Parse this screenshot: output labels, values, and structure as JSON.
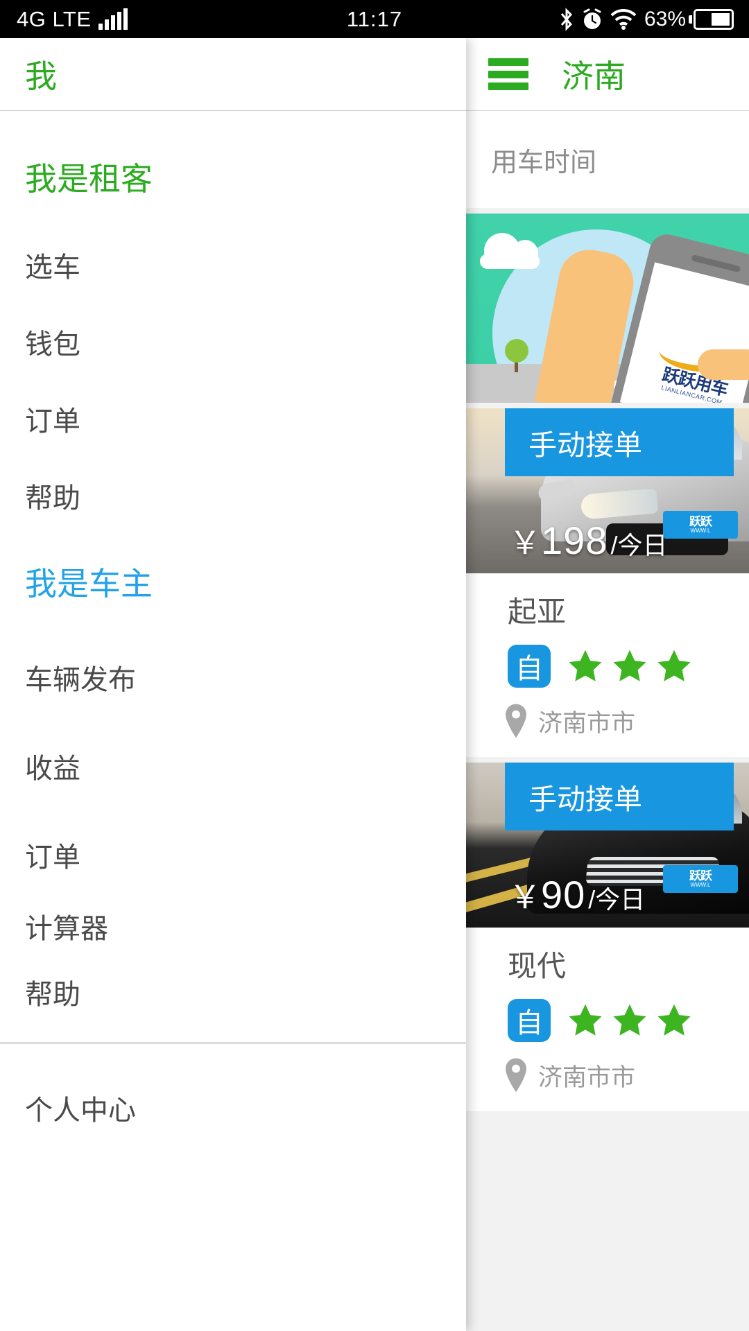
{
  "status_bar": {
    "network": "4G LTE",
    "time": "11:17",
    "battery_percent": "63%",
    "icons": [
      "signal-bars-icon",
      "bluetooth-icon",
      "alarm-icon",
      "wifi-icon",
      "battery-icon"
    ]
  },
  "drawer": {
    "header_title": "我",
    "sections": [
      {
        "title": "我是租客",
        "color": "#2caa20",
        "items": [
          "选车",
          "钱包",
          "订单",
          "帮助"
        ]
      },
      {
        "title": "我是车主",
        "color": "#23a2e8",
        "items": [
          "车辆发布",
          "收益",
          "订单",
          "计算器",
          "帮助"
        ]
      }
    ],
    "footer_item": "个人中心"
  },
  "main": {
    "menu_icon": "hamburger-icon",
    "city": "济南",
    "time_filter_label": "用车时间",
    "banner": {
      "logo_cn": "跃跃用车",
      "logo_en": "LIANLIANCAR.COM"
    },
    "cards": [
      {
        "badge": "手动接单",
        "currency": "￥",
        "price": "198",
        "period": "/今日",
        "brand": "起亚",
        "transmission_badge": "自",
        "stars": 3,
        "location": "济南市市",
        "plate_cn": "跃跃",
        "plate_en": "WWW.L"
      },
      {
        "badge": "手动接单",
        "currency": "￥",
        "price": "90",
        "period": "/今日",
        "brand": "现代",
        "transmission_badge": "自",
        "stars": 3,
        "location": "济南市市",
        "plate_cn": "跃跃",
        "plate_en": "WWW.L"
      }
    ]
  },
  "colors": {
    "renter_green": "#2caa20",
    "owner_blue": "#23a2e8",
    "badge_blue": "#1896e0",
    "star_green": "#3cb521",
    "banner_teal": "#3fd0a8"
  }
}
